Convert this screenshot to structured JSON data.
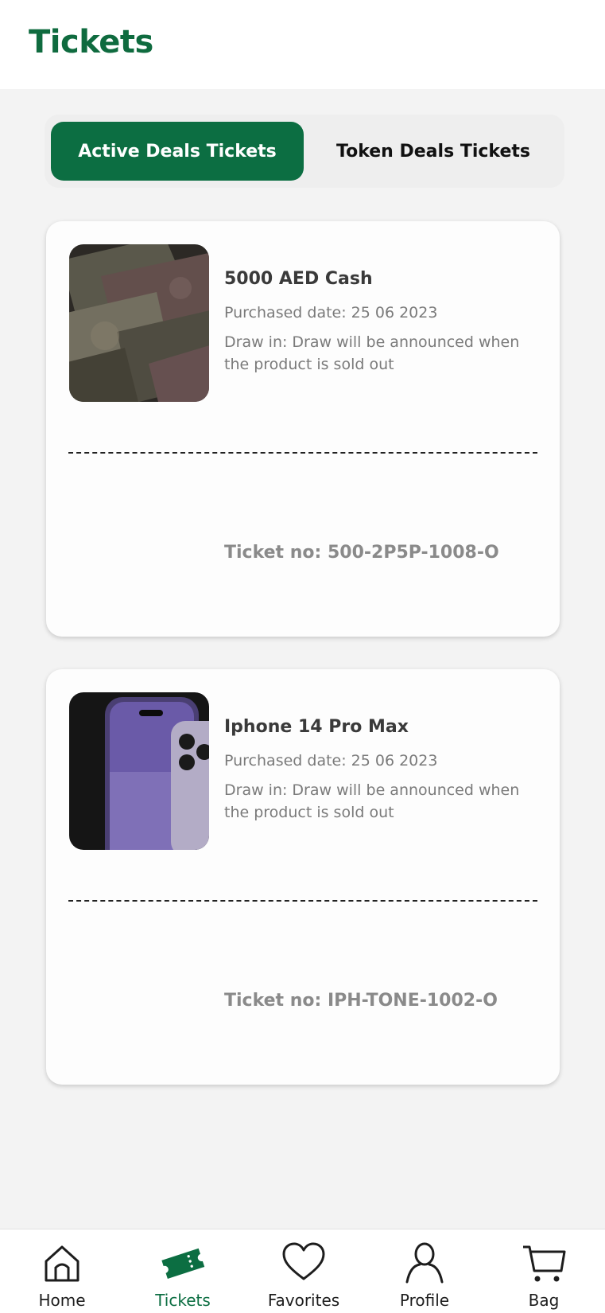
{
  "header": {
    "title": "Tickets"
  },
  "tabs": [
    {
      "label": "Active Deals Tickets",
      "active": true
    },
    {
      "label": "Token Deals Tickets",
      "active": false
    }
  ],
  "tickets": [
    {
      "product": "5000 AED Cash",
      "purchased": "Purchased date: 25 06 2023",
      "draw": "Draw in: Draw will be announced when the product is sold out",
      "ticket_no": "Ticket no: 500-2P5P-1008-O",
      "image": "cash-banknotes-image"
    },
    {
      "product": "Iphone 14 Pro Max",
      "purchased": "Purchased date: 25 06 2023",
      "draw": "Draw in: Draw will be announced when the product is sold out",
      "ticket_no": "Ticket no: IPH-TONE-1002-O",
      "image": "iphone-image"
    }
  ],
  "nav": [
    {
      "label": "Home",
      "icon": "home-icon"
    },
    {
      "label": "Tickets",
      "icon": "ticket-icon",
      "active": true
    },
    {
      "label": "Favorites",
      "icon": "heart-icon"
    },
    {
      "label": "Profile",
      "icon": "user-icon"
    },
    {
      "label": "Bag",
      "icon": "cart-icon"
    }
  ],
  "colors": {
    "brand_green": "#0c6e42",
    "title_green": "#0f6b3f",
    "background": "#f3f3f3"
  }
}
